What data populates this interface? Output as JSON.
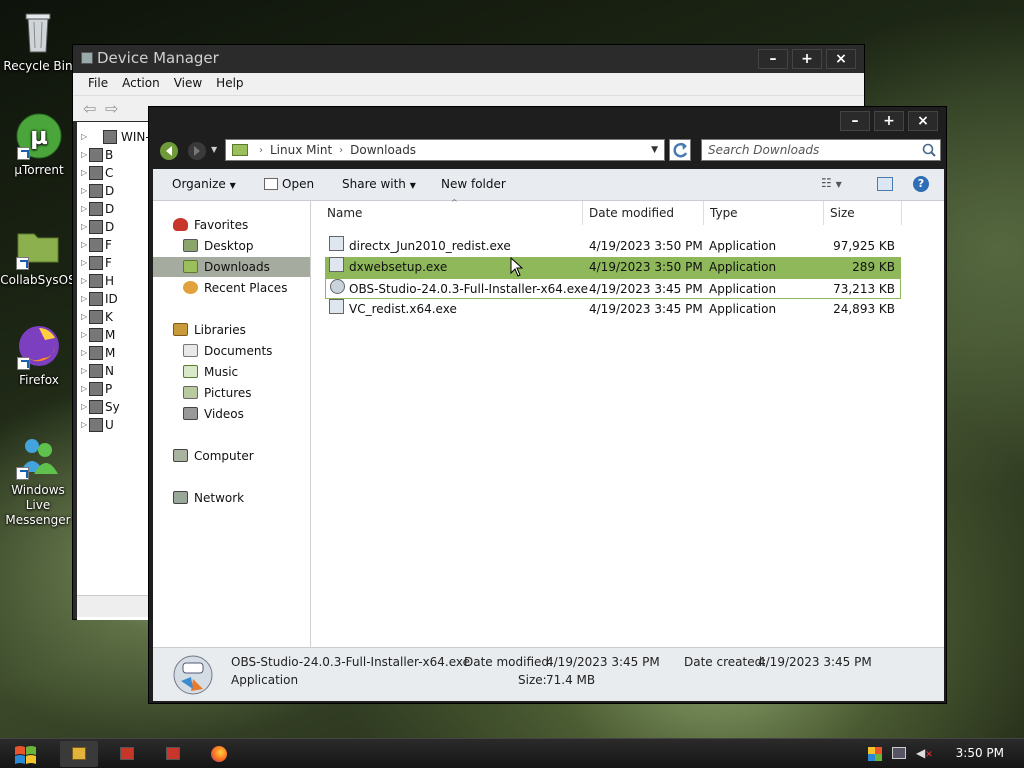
{
  "desktop": {
    "icons": [
      {
        "label": "Recycle Bin",
        "icon": "recycle-bin-icon"
      },
      {
        "label": "µTorrent",
        "icon": "utorrent-icon"
      },
      {
        "label": "CollabSysOS",
        "icon": "folder-icon"
      },
      {
        "label": "Firefox",
        "icon": "firefox-icon"
      },
      {
        "label": "Windows Live Messenger",
        "icon": "messenger-icon"
      }
    ]
  },
  "device_manager": {
    "title": "Device Manager",
    "menu": [
      "File",
      "Action",
      "View",
      "Help"
    ],
    "tree_root": "WIN-",
    "tree_items": [
      "B",
      "C",
      "D",
      "D",
      "D",
      "F",
      "F",
      "H",
      "ID",
      "K",
      "M",
      "M",
      "N",
      "P",
      "Sy",
      "U"
    ]
  },
  "explorer": {
    "breadcrumb": [
      "Linux Mint",
      "Downloads"
    ],
    "search_placeholder": "Search Downloads",
    "commands": {
      "organize": "Organize",
      "open": "Open",
      "share_with": "Share with",
      "new_folder": "New folder"
    },
    "nav": {
      "favorites": "Favorites",
      "desktop": "Desktop",
      "downloads": "Downloads",
      "recent_places": "Recent Places",
      "libraries": "Libraries",
      "documents": "Documents",
      "music": "Music",
      "pictures": "Pictures",
      "videos": "Videos",
      "computer": "Computer",
      "network": "Network"
    },
    "columns": {
      "name": "Name",
      "date": "Date modified",
      "type": "Type",
      "size": "Size"
    },
    "files": [
      {
        "name": "directx_Jun2010_redist.exe",
        "date": "4/19/2023 3:50 PM",
        "type": "Application",
        "size": "97,925 KB"
      },
      {
        "name": "dxwebsetup.exe",
        "date": "4/19/2023 3:50 PM",
        "type": "Application",
        "size": "289 KB"
      },
      {
        "name": "OBS-Studio-24.0.3-Full-Installer-x64.exe",
        "date": "4/19/2023 3:45 PM",
        "type": "Application",
        "size": "73,213 KB"
      },
      {
        "name": "VC_redist.x64.exe",
        "date": "4/19/2023 3:45 PM",
        "type": "Application",
        "size": "24,893 KB"
      }
    ],
    "details": {
      "filename": "OBS-Studio-24.0.3-Full-Installer-x64.exe",
      "filetype": "Application",
      "date_modified_label": "Date modified:",
      "date_modified": "4/19/2023 3:45 PM",
      "date_created_label": "Date created:",
      "date_created": "4/19/2023 3:45 PM",
      "size_label": "Size:",
      "size": "71.4 MB"
    }
  },
  "taskbar": {
    "clock": "3:50 PM"
  },
  "colors": {
    "selection": "#8fb85a",
    "nav_selected": "#a5ab9e"
  }
}
